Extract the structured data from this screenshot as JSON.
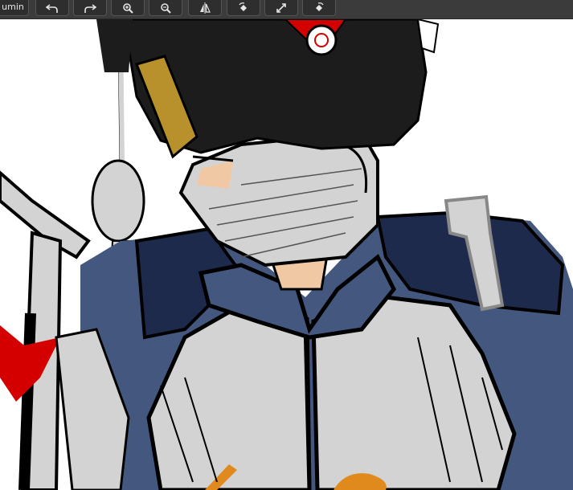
{
  "toolbar": {
    "label": "umin",
    "buttons": [
      {
        "name": "undo-button",
        "icon": "undo-arrow-icon"
      },
      {
        "name": "redo-button",
        "icon": "redo-arrow-icon"
      },
      {
        "name": "zoom-in-button",
        "icon": "zoom-in-icon"
      },
      {
        "name": "zoom-out-button",
        "icon": "zoom-out-icon"
      },
      {
        "name": "flip-button",
        "icon": "flip-horizontal-icon"
      },
      {
        "name": "rotate-left-button",
        "icon": "rotate-left-icon"
      },
      {
        "name": "fit-screen-button",
        "icon": "expand-arrows-icon"
      },
      {
        "name": "rotate-right-button",
        "icon": "rotate-right-icon"
      }
    ]
  },
  "canvas": {
    "content": "drawing-sketch",
    "colors": {
      "hat": "#1c1c1c",
      "jacket": "#43577f",
      "jacket_dark": "#1d2a4b",
      "bandage": "#d3d3d3",
      "skin": "#f1c8a4",
      "accent_red": "#d40000",
      "gold": "#b8902c",
      "orange": "#e08a1e"
    }
  }
}
